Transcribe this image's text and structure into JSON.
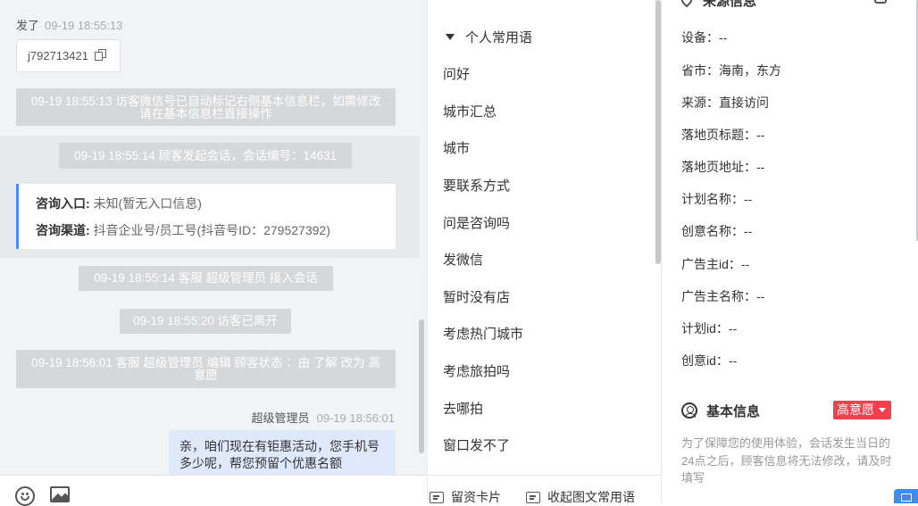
{
  "chat": {
    "sender_line": {
      "name": "发了",
      "time": "09-19 18:55:13"
    },
    "wechat_id": "j792713421",
    "system_msgs": {
      "m1": "09-19 18:55:13 访客微信号已自动标记右侧基本信息栏，如需修改请在基本信息栏直接操作",
      "m2": "09-19 18:55:14 顾客发起会话，会话编号：14631",
      "m3": "09-19 18:55:14 客服 超级管理员 接入会话",
      "m4": "09-19 18:55:20 访客已离开",
      "m5": "09-19 18:56:01 客服 超级管理员 编辑 顾客状态 ：由 了解 改为 高意愿"
    },
    "consult_card": {
      "entry_label": "咨询入口:",
      "entry_value": "未知(暂无入口信息)",
      "channel_label": "咨询渠道:",
      "channel_value": "抖音企业号/员工号(抖音号ID：279527392)"
    },
    "agent_msg": {
      "name": "超级管理员",
      "time": "09-19 18:56:01",
      "text": "亲，咱们现在有钜惠活动，您手机号多少呢，帮您预留个优惠名额"
    }
  },
  "phrases": {
    "group_label": "个人常用语",
    "items": [
      "问好",
      "城市汇总",
      "城市",
      "要联系方式",
      "问是咨询吗",
      "发微信",
      "暂时没有店",
      "考虑热门城市",
      "考虑旅拍吗",
      "去哪拍",
      "窗口发不了"
    ],
    "footer": {
      "card_label": "留资卡片",
      "collapse_label": "收起图文常用语"
    }
  },
  "info": {
    "source_title": "来源信息",
    "rows": [
      {
        "label": "设备：",
        "value": "--"
      },
      {
        "label": "省市：",
        "value": "海南，东方"
      },
      {
        "label": "来源：",
        "value": "直接访问"
      },
      {
        "label": "落地页标题：",
        "value": "--"
      },
      {
        "label": "落地页地址：",
        "value": "--"
      },
      {
        "label": "计划名称：",
        "value": "--"
      },
      {
        "label": "创意名称：",
        "value": "--"
      },
      {
        "label": "广告主id：",
        "value": "--"
      },
      {
        "label": "广告主名称：",
        "value": "--"
      },
      {
        "label": "计划id：",
        "value": "--"
      },
      {
        "label": "创意id：",
        "value": "--"
      }
    ],
    "basic_title": "基本信息",
    "status": "高意愿",
    "notice": "为了保障您的使用体验，会话发生当日的24点之后，顾客信息将无法修改，请及时填写"
  },
  "colors": {
    "accent_blue": "#4a8cff",
    "status_red": "#f43f4d",
    "agent_bubble": "#dfe9fc"
  }
}
